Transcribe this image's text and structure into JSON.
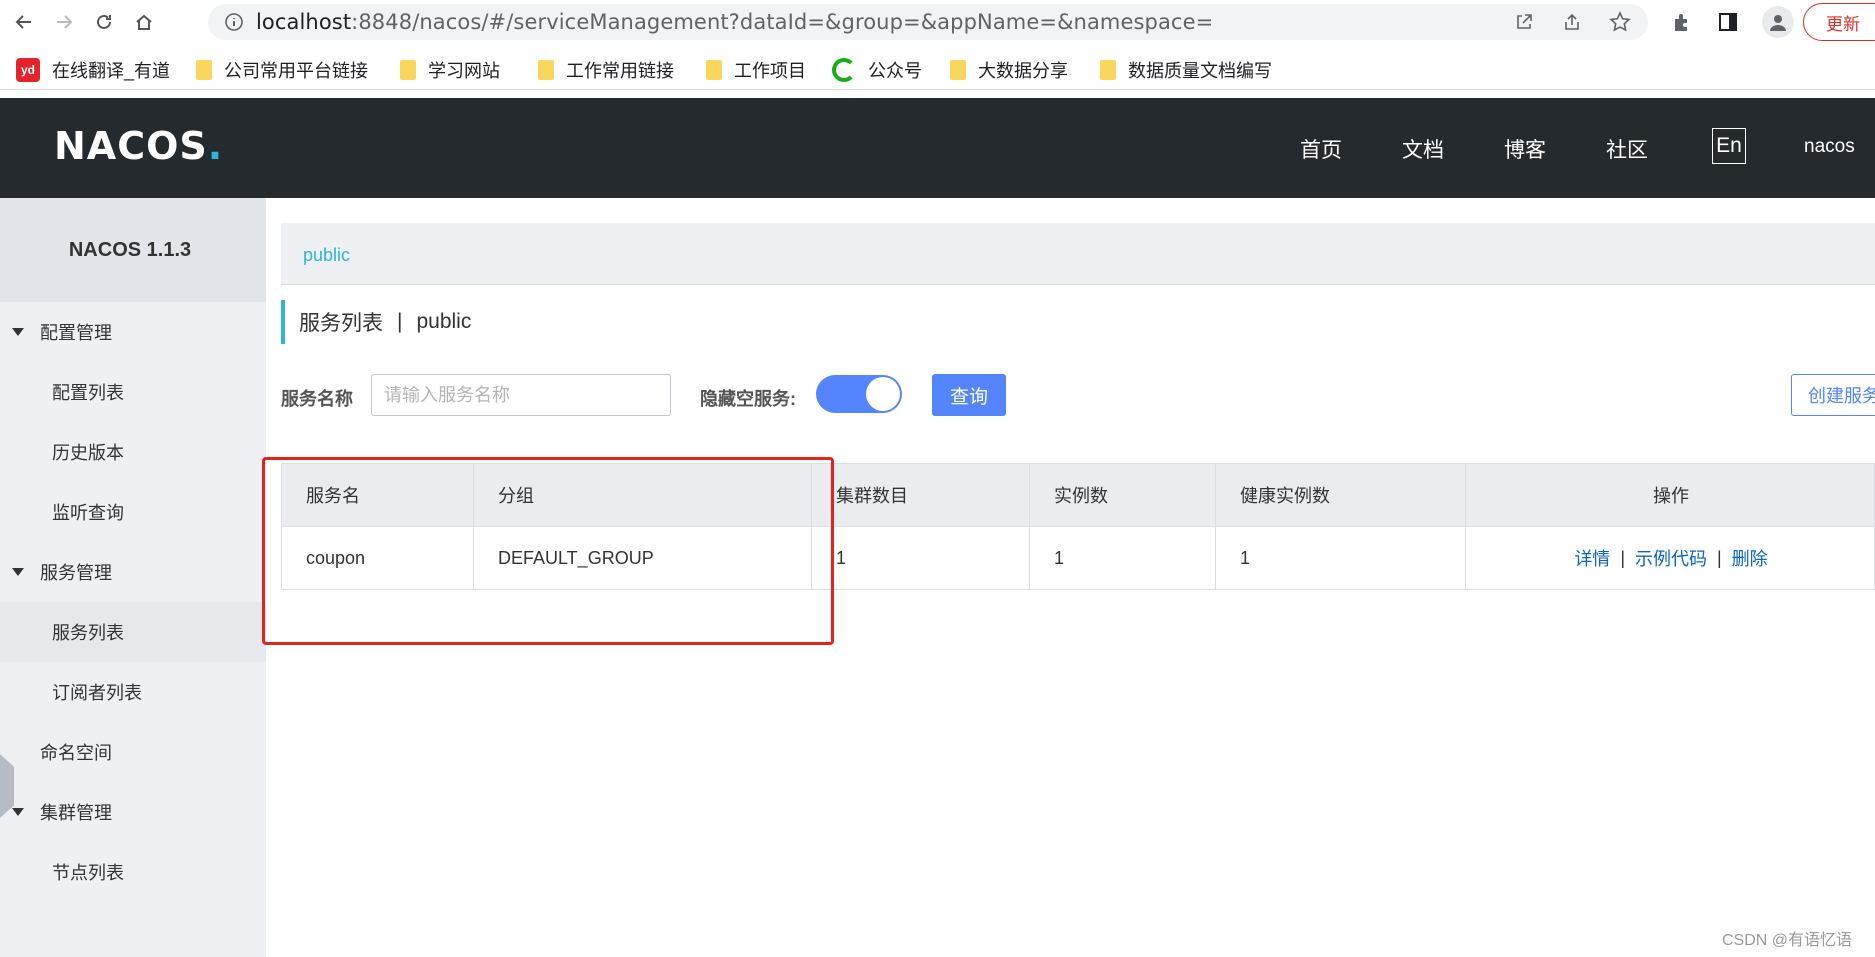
{
  "browser": {
    "url_host": "localhost",
    "url_rest": ":8848/nacos/#/serviceManagement?dataId=&group=&appName=&namespace=",
    "update_label": "更新",
    "bookmarks": [
      {
        "label": "在线翻译_有道",
        "icon": "youdao-icon"
      },
      {
        "label": "公司常用平台链接",
        "icon": "folder-icon"
      },
      {
        "label": "学习网站",
        "icon": "folder-icon"
      },
      {
        "label": "工作常用链接",
        "icon": "folder-icon"
      },
      {
        "label": "工作项目",
        "icon": "folder-icon"
      },
      {
        "label": "公众号",
        "icon": "wechat-icon"
      },
      {
        "label": "大数据分享",
        "icon": "folder-icon"
      },
      {
        "label": "数据质量文档编写",
        "icon": "folder-icon"
      }
    ]
  },
  "header": {
    "logo": "NACOS",
    "nav": [
      "首页",
      "文档",
      "博客",
      "社区"
    ],
    "lang": "En",
    "user": "nacos"
  },
  "sidebar": {
    "title": "NACOS 1.1.3",
    "items": [
      {
        "label": "配置管理",
        "type": "group"
      },
      {
        "label": "配置列表",
        "type": "sub"
      },
      {
        "label": "历史版本",
        "type": "sub"
      },
      {
        "label": "监听查询",
        "type": "sub"
      },
      {
        "label": "服务管理",
        "type": "group"
      },
      {
        "label": "服务列表",
        "type": "sub",
        "active": true
      },
      {
        "label": "订阅者列表",
        "type": "sub"
      },
      {
        "label": "命名空间",
        "type": "plain"
      },
      {
        "label": "集群管理",
        "type": "group"
      },
      {
        "label": "节点列表",
        "type": "sub"
      }
    ]
  },
  "main": {
    "breadcrumb": "public",
    "title": "服务列表",
    "title_sep": "|",
    "namespace": "public",
    "filter": {
      "service_name_label": "服务名称",
      "service_name_placeholder": "请输入服务名称",
      "hide_empty_label": "隐藏空服务:",
      "hide_empty_on": true,
      "query_label": "查询",
      "create_label": "创建服务"
    },
    "table": {
      "columns": [
        "服务名",
        "分组",
        "集群数目",
        "实例数",
        "健康实例数",
        "操作"
      ],
      "rows": [
        {
          "name": "coupon",
          "group": "DEFAULT_GROUP",
          "clusters": "1",
          "instances": "1",
          "healthy": "1"
        }
      ],
      "ops": [
        "详情",
        "示例代码",
        "删除"
      ],
      "ops_sep": "|"
    }
  },
  "watermark": "CSDN @有语忆语",
  "colors": {
    "accent": "#5584ff",
    "header_bg": "#252a2f",
    "link": "#0b63c5",
    "highlight": "#e5231d"
  }
}
